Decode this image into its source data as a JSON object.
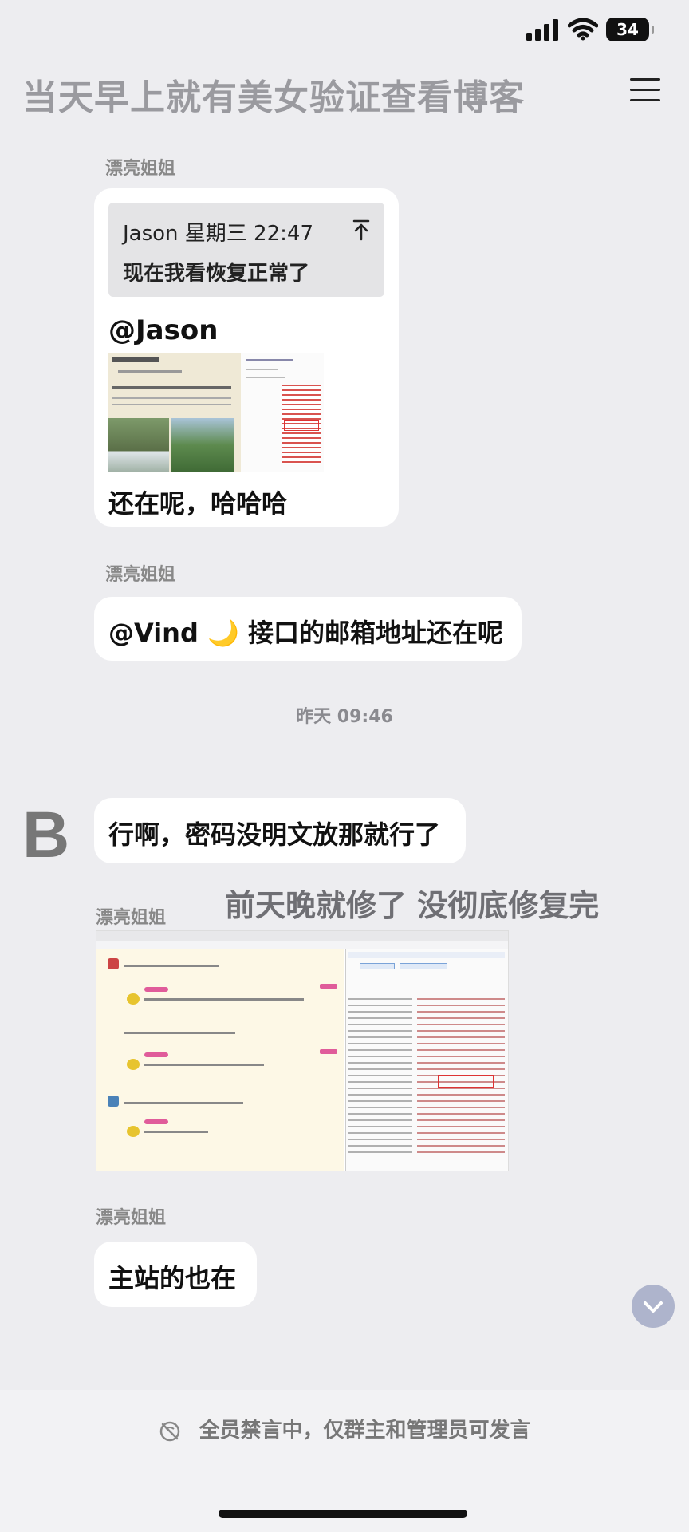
{
  "status_bar": {
    "battery": "34"
  },
  "header": {
    "title": "当天早上就有美女验证查看博客"
  },
  "messages": {
    "m1": {
      "sender": "漂亮姐姐",
      "quote": {
        "author_time": "Jason 星期三 22:47",
        "text": "现在我看恢复正常了"
      },
      "mention": "@Jason",
      "text": "还在呢，哈哈哈"
    },
    "m2": {
      "sender": "漂亮姐姐",
      "text": "@Vind 🌙 接口的邮箱地址还在呢"
    },
    "timestamp": "昨天 09:46",
    "m3": {
      "avatar_letter": "B",
      "text": "行啊，密码没明文放那就行了"
    },
    "overlay": "前天晚就修了 没彻底修复完",
    "m4": {
      "sender": "漂亮姐姐"
    },
    "m5": {
      "sender": "漂亮姐姐",
      "text": "主站的也在"
    }
  },
  "footer": {
    "notice": "全员禁言中，仅群主和管理员可发言"
  },
  "icons": {
    "signal": "signal-icon",
    "wifi": "wifi-icon",
    "menu": "menu-icon",
    "quote": "jump-to-quote-icon",
    "scroll": "chevron-down-icon",
    "mute": "mute-icon"
  }
}
